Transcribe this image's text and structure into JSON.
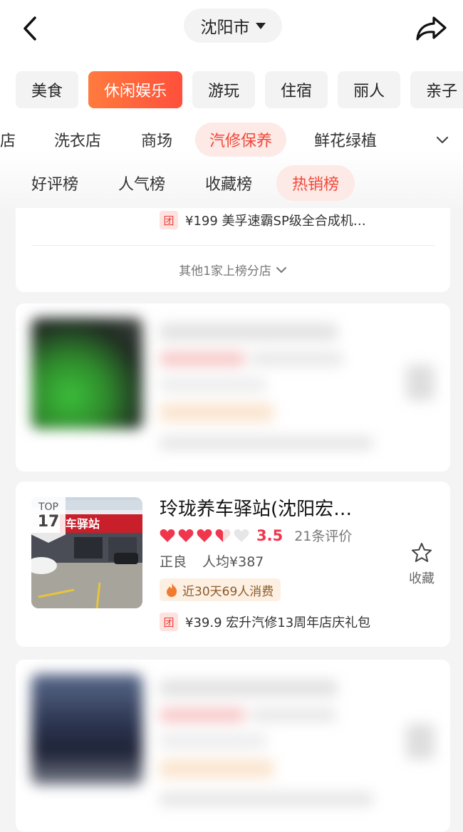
{
  "header": {
    "city": "沈阳市"
  },
  "categories": [
    {
      "label": "美食"
    },
    {
      "label": "休闲娱乐"
    },
    {
      "label": "游玩"
    },
    {
      "label": "住宿"
    },
    {
      "label": "丽人"
    },
    {
      "label": "亲子"
    }
  ],
  "subcategories": [
    {
      "label": "店"
    },
    {
      "label": "洗衣店"
    },
    {
      "label": "商场"
    },
    {
      "label": "汽修保养"
    },
    {
      "label": "鲜花绿植"
    }
  ],
  "rank_tabs": [
    {
      "label": "好评榜"
    },
    {
      "label": "人气榜"
    },
    {
      "label": "收藏榜"
    },
    {
      "label": "热销榜"
    }
  ],
  "card_top": {
    "deal_icon": "团",
    "deal_text": "¥199 美孚速霸SP级全合成机…",
    "more_branches": "其他1家上榜分店"
  },
  "featured": {
    "rank_prefix": "TOP",
    "rank": "17",
    "name": "玲珑养车驿站(沈阳宏…",
    "rating": 3.5,
    "score_text": "3.5",
    "reviews": "21条评价",
    "area": "正良",
    "avg_price": "人均¥387",
    "hot_text": "近30天69人消费",
    "deal_icon": "团",
    "deal_text": "¥39.9 宏升汽修13周年店庆礼包",
    "fav_label": "收藏",
    "photo_sign": "车驿站"
  },
  "colors": {
    "accent": "#ff4f3b",
    "heart": "#f0364c",
    "active_pill_bg": "#fde9e6"
  }
}
